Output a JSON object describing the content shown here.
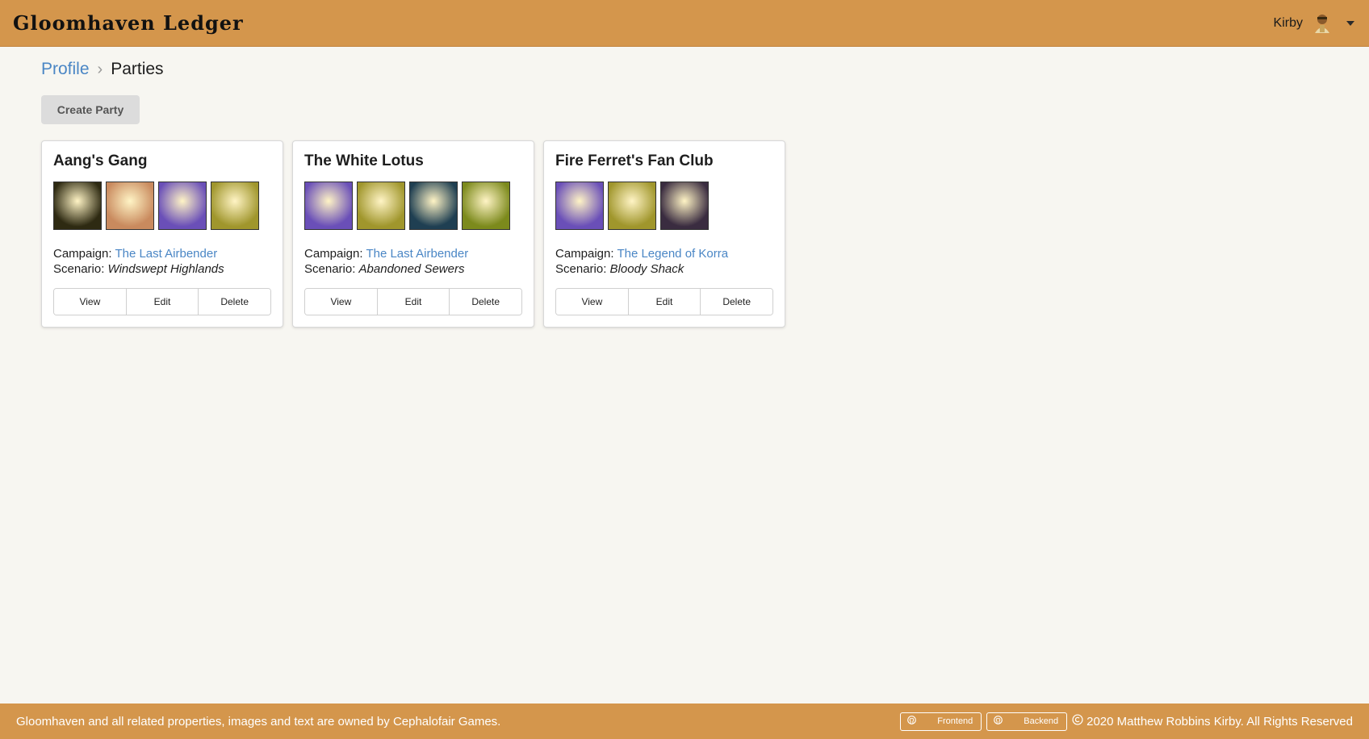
{
  "header": {
    "brand": "Gloomhaven Ledger",
    "user_name": "Kirby",
    "avatar_icon": "character-avatar-icon"
  },
  "breadcrumb": {
    "link": "Profile",
    "current": "Parties"
  },
  "actions": {
    "create_party": "Create Party"
  },
  "parties": [
    {
      "name": "Aang's Gang",
      "portraits": [
        "#2e2a12",
        "#c98a5e",
        "#6a4fb8",
        "#a0962c"
      ],
      "campaign_label": "Campaign:",
      "campaign": "The Last Airbender",
      "scenario_label": "Scenario:",
      "scenario": "Windswept Highlands",
      "buttons": {
        "view": "View",
        "edit": "Edit",
        "delete": "Delete"
      }
    },
    {
      "name": "The White Lotus",
      "portraits": [
        "#6a4fb8",
        "#a0962c",
        "#1f3f52",
        "#7c8a1c"
      ],
      "campaign_label": "Campaign:",
      "campaign": "The Last Airbender",
      "scenario_label": "Scenario:",
      "scenario": "Abandoned Sewers",
      "buttons": {
        "view": "View",
        "edit": "Edit",
        "delete": "Delete"
      }
    },
    {
      "name": "Fire Ferret's Fan Club",
      "portraits": [
        "#6a4fb8",
        "#a0962c",
        "#3a2c40"
      ],
      "campaign_label": "Campaign:",
      "campaign": "The Legend of Korra",
      "scenario_label": "Scenario:",
      "scenario": "Bloody Shack",
      "buttons": {
        "view": "View",
        "edit": "Edit",
        "delete": "Delete"
      }
    }
  ],
  "footer": {
    "notice": "Gloomhaven and all related properties, images and text are owned by Cephalofair Games.",
    "frontend": "Frontend",
    "backend": "Backend",
    "copyright": "2020 Matthew Robbins Kirby. All Rights Reserved"
  },
  "colors": {
    "accent": "#d4964c",
    "link": "#4a86c5",
    "background": "#f7f6f1"
  }
}
